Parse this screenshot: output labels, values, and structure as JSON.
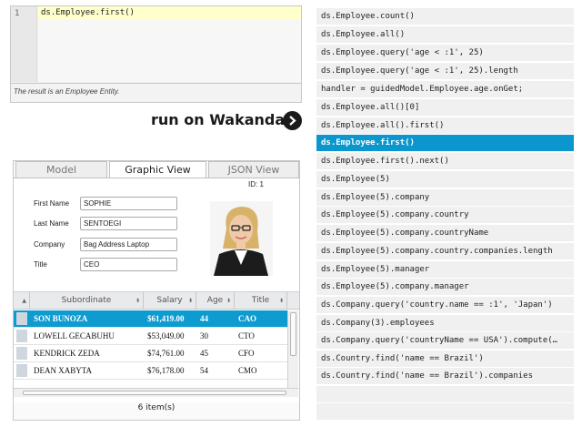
{
  "editor": {
    "line_number": "1",
    "code": "ds.Employee.first()",
    "result": "The result is an Employee Entity."
  },
  "run": {
    "label": "run on Wakanda",
    "icon": "chevron-right-icon"
  },
  "viewer": {
    "tabs": [
      {
        "label": "Model",
        "active": false
      },
      {
        "label": "Graphic View",
        "active": true
      },
      {
        "label": "JSON View",
        "active": false
      }
    ],
    "id_label": "ID: 1",
    "fields": [
      {
        "label": "First Name",
        "value": "SOPHIE"
      },
      {
        "label": "Last Name",
        "value": "SENTOEGI"
      },
      {
        "label": "Company",
        "value": "Bag Address Laptop"
      },
      {
        "label": "Title",
        "value": "CEO"
      }
    ],
    "table": {
      "columns": [
        "Subordinate",
        "Salary",
        "Age",
        "Title"
      ],
      "rows": [
        {
          "name": "SON BUNOZA",
          "salary": "$61,419.00",
          "age": "44",
          "title": "CAO",
          "selected": true
        },
        {
          "name": "LOWELL GECABUHU",
          "salary": "$53,049.00",
          "age": "30",
          "title": "CTO",
          "selected": false
        },
        {
          "name": "KENDRICK ZEDA",
          "salary": "$74,761.00",
          "age": "45",
          "title": "CFO",
          "selected": false
        },
        {
          "name": "DEAN XABYTA",
          "salary": "$76,178.00",
          "age": "54",
          "title": "CMO",
          "selected": false
        }
      ]
    },
    "count": "6 item(s)"
  },
  "examples": [
    {
      "text": "ds.Employee.count()",
      "active": false
    },
    {
      "text": "ds.Employee.all()",
      "active": false
    },
    {
      "text": "ds.Employee.query('age < :1', 25)",
      "active": false
    },
    {
      "text": "ds.Employee.query('age < :1', 25).length",
      "active": false
    },
    {
      "text": "handler = guidedModel.Employee.age.onGet;",
      "active": false
    },
    {
      "text": "ds.Employee.all()[0]",
      "active": false
    },
    {
      "text": "ds.Employee.all().first()",
      "active": false
    },
    {
      "text": "ds.Employee.first()",
      "active": true
    },
    {
      "text": "ds.Employee.first().next()",
      "active": false
    },
    {
      "text": "ds.Employee(5)",
      "active": false
    },
    {
      "text": "ds.Employee(5).company",
      "active": false
    },
    {
      "text": "ds.Employee(5).company.country",
      "active": false
    },
    {
      "text": "ds.Employee(5).company.countryName",
      "active": false
    },
    {
      "text": "ds.Employee(5).company.country.companies.length",
      "active": false
    },
    {
      "text": "ds.Employee(5).manager",
      "active": false
    },
    {
      "text": "ds.Employee(5).company.manager",
      "active": false
    },
    {
      "text": "ds.Company.query('country.name == :1', 'Japan')",
      "active": false
    },
    {
      "text": "ds.Company(3).employees",
      "active": false
    },
    {
      "text": "ds.Company.query('countryName == USA').compute(…",
      "active": false
    },
    {
      "text": "ds.Country.find('name == Brazil')",
      "active": false
    },
    {
      "text": "ds.Country.find('name == Brazil').companies",
      "active": false
    }
  ],
  "colors": {
    "accent": "#0b97cd",
    "row_selected": "#0e9bd0",
    "editor_highlight": "#ffffcc"
  }
}
